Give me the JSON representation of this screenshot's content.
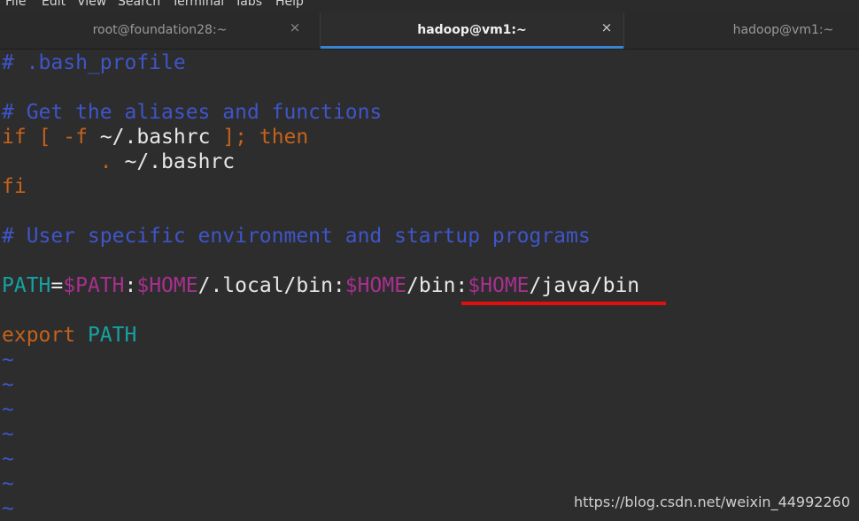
{
  "menu": [
    "File",
    "Edit",
    "View",
    "Search",
    "Terminal",
    "Tabs",
    "Help"
  ],
  "tabs": [
    {
      "label": "root@foundation28:~",
      "close": "×",
      "active": false
    },
    {
      "label": "hadoop@vm1:~",
      "close": "×",
      "active": true
    },
    {
      "label": "hadoop@vm1:~",
      "active": false
    }
  ],
  "editor": {
    "lines": [
      [
        {
          "t": "# .bash_profile",
          "c": "comment"
        }
      ],
      [],
      [
        {
          "t": "# Get the aliases and functions",
          "c": "comment"
        }
      ],
      [
        {
          "t": "if",
          "c": "keyword"
        },
        {
          "t": " ",
          "c": "plain"
        },
        {
          "t": "[ -f",
          "c": "keyword"
        },
        {
          "t": " ~/.bashrc ",
          "c": "plain"
        },
        {
          "t": "];",
          "c": "keyword"
        },
        {
          "t": " ",
          "c": "plain"
        },
        {
          "t": "then",
          "c": "keyword"
        }
      ],
      [
        {
          "t": "        ",
          "c": "plain"
        },
        {
          "t": ".",
          "c": "keyword"
        },
        {
          "t": " ~/.bashrc",
          "c": "plain"
        }
      ],
      [
        {
          "t": "fi",
          "c": "keyword"
        }
      ],
      [],
      [
        {
          "t": "# User specific environment and startup programs",
          "c": "comment"
        }
      ],
      [],
      [
        {
          "t": "PATH",
          "c": "ident"
        },
        {
          "t": "=",
          "c": "plain"
        },
        {
          "t": "$PATH",
          "c": "var"
        },
        {
          "t": ":",
          "c": "plain"
        },
        {
          "t": "$HOME",
          "c": "var"
        },
        {
          "t": "/.local/bin:",
          "c": "plain"
        },
        {
          "t": "$HOME",
          "c": "var"
        },
        {
          "t": "/bin:",
          "c": "plain"
        },
        {
          "t": "$HOME",
          "c": "var"
        },
        {
          "t": "/java/bin",
          "c": "plain"
        }
      ],
      [],
      [
        {
          "t": "export",
          "c": "keyword"
        },
        {
          "t": " ",
          "c": "plain"
        },
        {
          "t": "PATH",
          "c": "ident"
        }
      ],
      [
        {
          "t": "~",
          "c": "tilde"
        }
      ],
      [
        {
          "t": "~",
          "c": "tilde"
        }
      ],
      [
        {
          "t": "~",
          "c": "tilde"
        }
      ],
      [
        {
          "t": "~",
          "c": "tilde"
        }
      ],
      [
        {
          "t": "~",
          "c": "tilde"
        }
      ],
      [
        {
          "t": "~",
          "c": "tilde"
        }
      ],
      [
        {
          "t": "~",
          "c": "tilde"
        }
      ]
    ]
  },
  "watermark": "https://blog.csdn.net/weixin_44992260",
  "colors": {
    "comment": "#3f55c9",
    "keyword": "#c4621c",
    "variable": "#a8308f",
    "identifier": "#17a2a2",
    "tilde": "#3f55c9",
    "text": "#e8e8e8",
    "background": "#2d2d2d",
    "active_tab_underline": "#3a84d6",
    "annotation_underline": "#e0100f"
  }
}
